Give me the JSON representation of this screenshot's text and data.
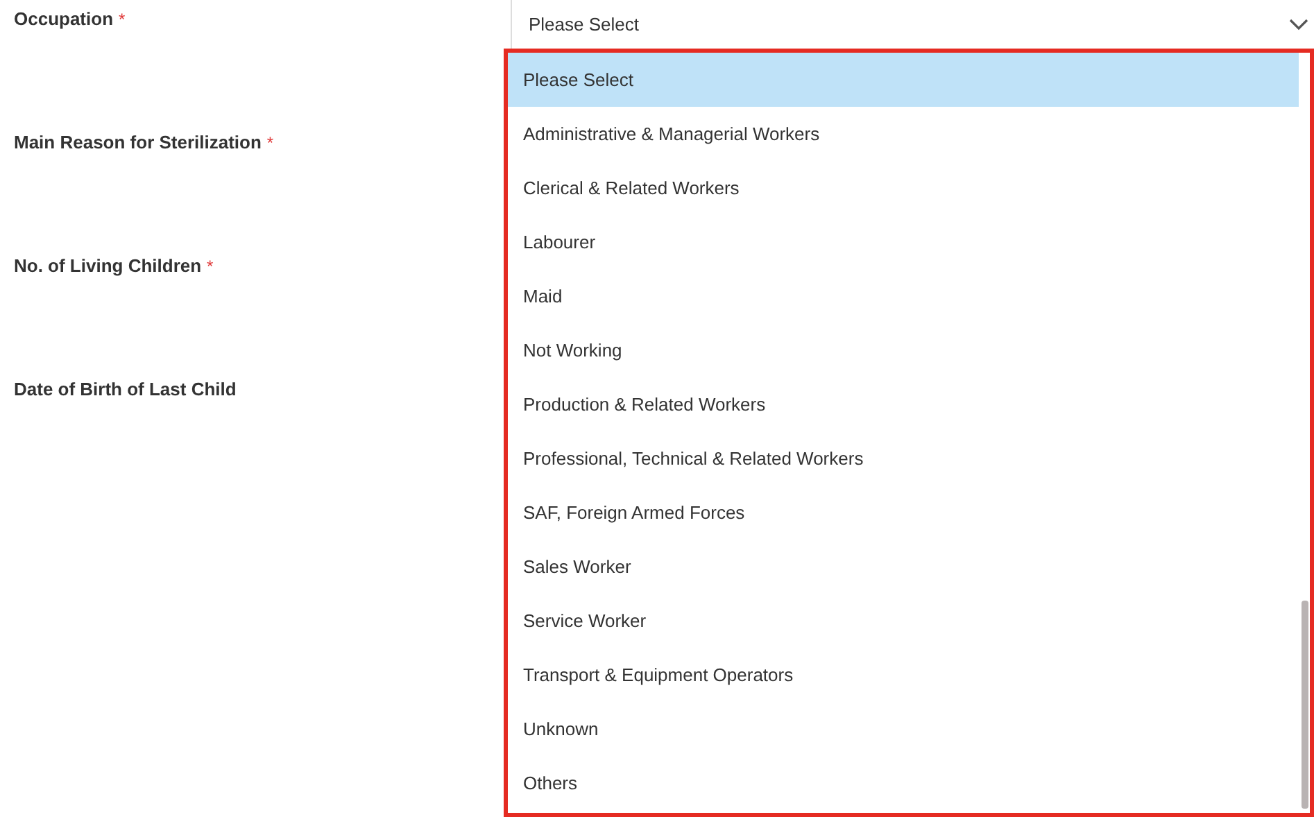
{
  "fields": [
    {
      "label": "Occupation",
      "required_mark": "*"
    },
    {
      "label": "Main Reason for Sterilization",
      "required_mark": "*"
    },
    {
      "label": "No. of Living Children",
      "required_mark": "*"
    },
    {
      "label": "Date of Birth of Last Child"
    }
  ],
  "select": {
    "value": "Please Select",
    "expanded": true
  },
  "options": [
    {
      "label": "Please Select",
      "selected": true
    },
    {
      "label": "Administrative & Managerial Workers",
      "selected": false
    },
    {
      "label": "Clerical & Related Workers",
      "selected": false
    },
    {
      "label": "Labourer",
      "selected": false
    },
    {
      "label": "Maid",
      "selected": false
    },
    {
      "label": "Not Working",
      "selected": false
    },
    {
      "label": "Production & Related Workers",
      "selected": false
    },
    {
      "label": "Professional, Technical & Related Workers",
      "selected": false
    },
    {
      "label": "SAF, Foreign Armed Forces",
      "selected": false
    },
    {
      "label": "Sales Worker",
      "selected": false
    },
    {
      "label": "Service Worker",
      "selected": false
    },
    {
      "label": "Transport & Equipment Operators",
      "selected": false
    },
    {
      "label": "Unknown",
      "selected": false
    },
    {
      "label": "Others",
      "selected": false
    }
  ]
}
